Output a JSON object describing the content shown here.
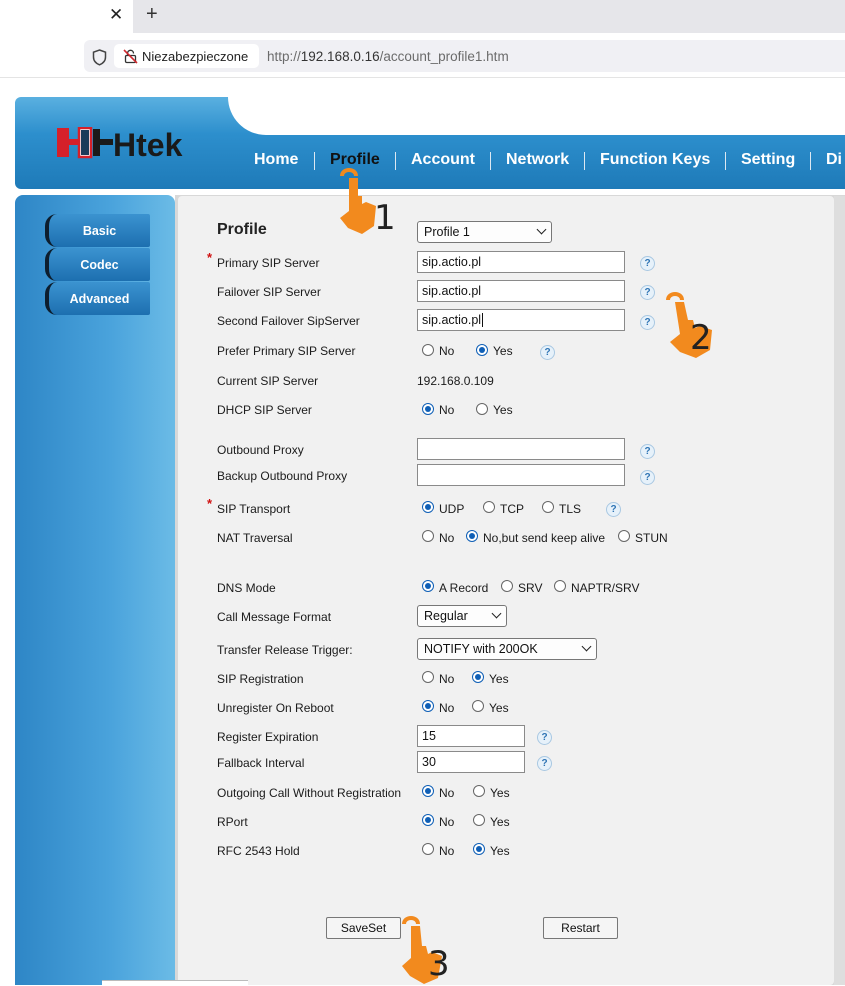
{
  "browser": {
    "close_glyph": "✕",
    "new_tab_glyph": "+",
    "security_label": "Niezabezpieczone",
    "url_scheme": "http://",
    "url_host": "192.168.0.16",
    "url_path": "/account_profile1.htm"
  },
  "header": {
    "logo_text": "Htek",
    "nav": [
      "Home",
      "Profile",
      "Account",
      "Network",
      "Function Keys",
      "Setting",
      "Di"
    ],
    "active_nav": "Profile"
  },
  "sidebar": {
    "items": [
      "Basic",
      "Codec",
      "Advanced"
    ]
  },
  "form": {
    "title": "Profile",
    "profile_select": "Profile 1",
    "primary_sip_server": {
      "label": "Primary SIP Server",
      "value": "sip.actio.pl"
    },
    "failover_sip_server": {
      "label": "Failover SIP Server",
      "value": "sip.actio.pl"
    },
    "second_failover": {
      "label": "Second Failover SipServer",
      "value": "sip.actio.pl"
    },
    "prefer_primary": {
      "label": "Prefer Primary SIP Server",
      "options": [
        "No",
        "Yes"
      ],
      "selected": "Yes"
    },
    "current_sip_server": {
      "label": "Current SIP Server",
      "value": "192.168.0.109"
    },
    "dhcp_sip_server": {
      "label": "DHCP SIP Server",
      "options": [
        "No",
        "Yes"
      ],
      "selected": "No"
    },
    "outbound_proxy": {
      "label": "Outbound Proxy",
      "value": ""
    },
    "backup_outbound_proxy": {
      "label": "Backup Outbound Proxy",
      "value": ""
    },
    "sip_transport": {
      "label": "SIP Transport",
      "options": [
        "UDP",
        "TCP",
        "TLS"
      ],
      "selected": "UDP"
    },
    "nat_traversal": {
      "label": "NAT Traversal",
      "options": [
        "No",
        "No,but send keep alive",
        "STUN"
      ],
      "selected": "No,but send keep alive"
    },
    "dns_mode": {
      "label": "DNS Mode",
      "options": [
        "A Record",
        "SRV",
        "NAPTR/SRV"
      ],
      "selected": "A Record"
    },
    "call_message_format": {
      "label": "Call Message Format",
      "value": "Regular"
    },
    "transfer_release_trigger": {
      "label": "Transfer Release Trigger:",
      "value": "NOTIFY with 200OK"
    },
    "sip_registration": {
      "label": "SIP Registration",
      "options": [
        "No",
        "Yes"
      ],
      "selected": "Yes"
    },
    "unregister_on_reboot": {
      "label": "Unregister On Reboot",
      "options": [
        "No",
        "Yes"
      ],
      "selected": "No"
    },
    "register_expiration": {
      "label": "Register Expiration",
      "value": "15"
    },
    "fallback_interval": {
      "label": "Fallback Interval",
      "value": "30"
    },
    "outgoing_without_registration": {
      "label": "Outgoing Call Without Registration",
      "options": [
        "No",
        "Yes"
      ],
      "selected": "No"
    },
    "rport": {
      "label": "RPort",
      "options": [
        "No",
        "Yes"
      ],
      "selected": "No"
    },
    "rfc2543_hold": {
      "label": "RFC 2543 Hold",
      "options": [
        "No",
        "Yes"
      ],
      "selected": "Yes"
    },
    "required_mark": "*",
    "help_glyph": "?"
  },
  "buttons": {
    "save": "SaveSet",
    "restart": "Restart"
  },
  "annotations": {
    "step1": "1",
    "step2": "2",
    "step3": "3",
    "color": "#f28a1e"
  }
}
